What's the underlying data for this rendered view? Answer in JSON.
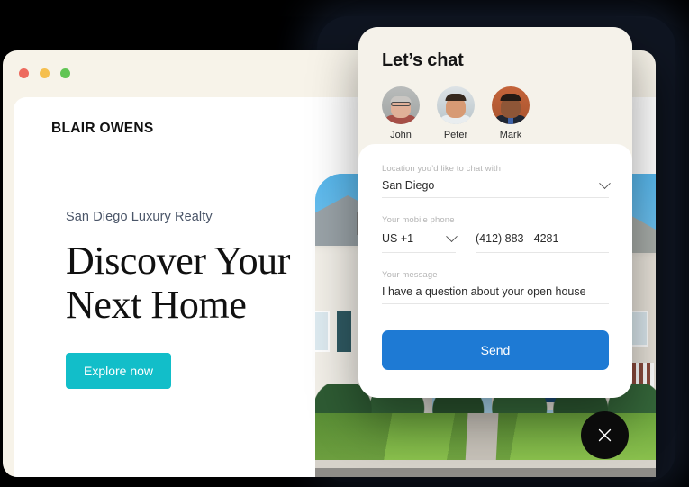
{
  "browser": {
    "traffic_lights": [
      {
        "name": "close",
        "color": "#ED6A5E"
      },
      {
        "name": "minimize",
        "color": "#F5BF4F"
      },
      {
        "name": "maximize",
        "color": "#61C554"
      }
    ],
    "site": {
      "logo": "BLAIR OWENS",
      "hero": {
        "eyebrow": "San Diego Luxury Realty",
        "headline_line1": "Discover Your",
        "headline_line2": "Next Home",
        "cta_label": "Explore now",
        "cta_color": "#12BEC9"
      }
    }
  },
  "chat": {
    "title": "Let’s chat",
    "agents": [
      {
        "name": "John"
      },
      {
        "name": "Peter"
      },
      {
        "name": "Mark"
      }
    ],
    "form": {
      "location": {
        "label": "Location you’d like to chat with",
        "value": "San Diego"
      },
      "phone": {
        "label": "Your mobile phone",
        "country_code": "US +1",
        "number": "(412) 883 - 4281"
      },
      "message": {
        "label": "Your message",
        "value": "I have a question about your open house"
      },
      "submit_label": "Send",
      "submit_color": "#1E7AD4"
    },
    "close_label": "×"
  }
}
